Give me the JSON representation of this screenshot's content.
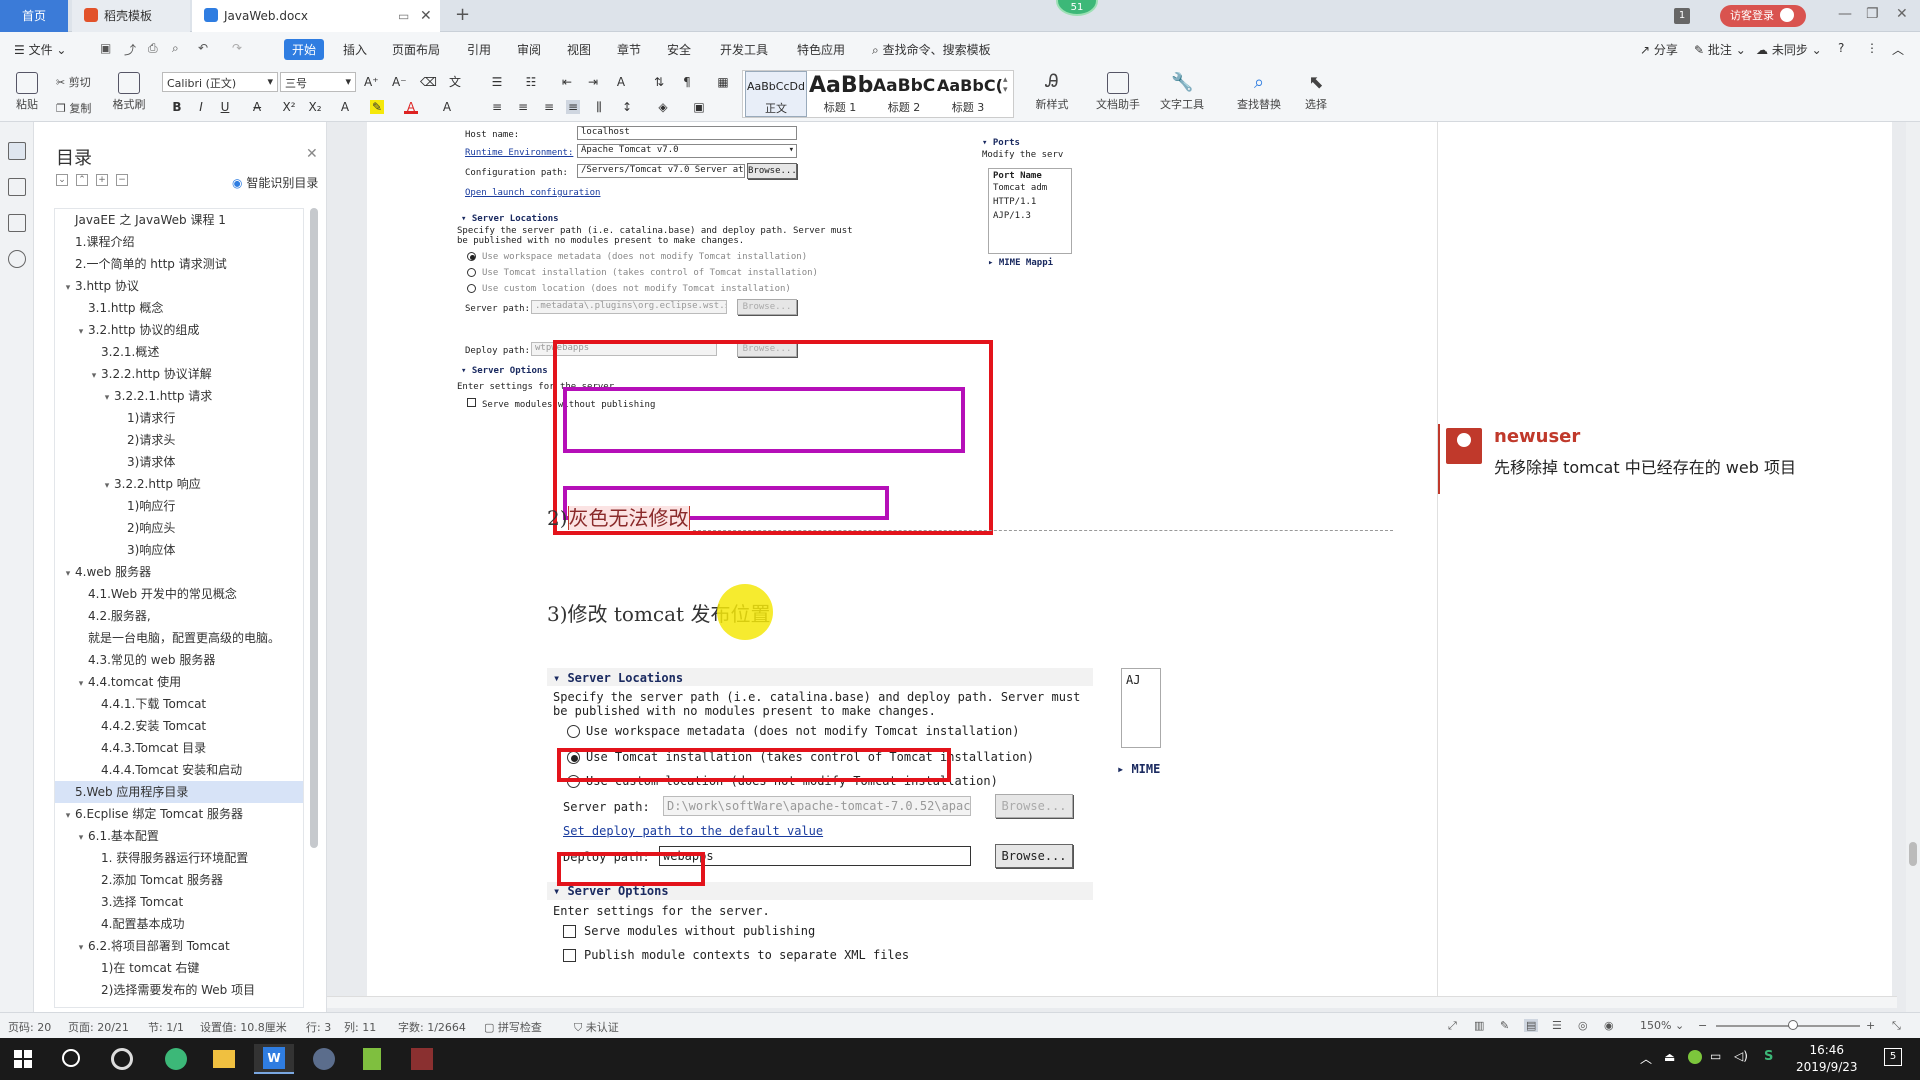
{
  "tabs": {
    "home": "首页",
    "template": "稻壳模板",
    "document": "JavaWeb.docx",
    "window_count": "1",
    "login": "访客登录",
    "float_badge": "51"
  },
  "menubar": {
    "file": "文件",
    "start": "开始",
    "items": [
      "插入",
      "页面布局",
      "引用",
      "审阅",
      "视图",
      "章节",
      "安全",
      "开发工具",
      "特色应用"
    ],
    "search": "查找命令、搜索模板",
    "share": "分享",
    "annotate": "批注",
    "sync": "未同步"
  },
  "toolbar": {
    "paste": "粘贴",
    "cut": "剪切",
    "copy": "复制",
    "format_painter": "格式刷",
    "font_name": "Calibri (正文)",
    "font_size": "三号",
    "styles": [
      {
        "preview": "AaBbCcDd",
        "label": "正文"
      },
      {
        "preview": "AaBb",
        "label": "标题 1"
      },
      {
        "preview": "AaBbC",
        "label": "标题 2"
      },
      {
        "preview": "AaBbC(",
        "label": "标题 3"
      }
    ],
    "new_style": "新样式",
    "doc_helper": "文档助手",
    "text_tools": "文字工具",
    "find_replace": "查找替换",
    "select": "选择"
  },
  "toc": {
    "title": "目录",
    "smart": "智能识别目录",
    "items": [
      {
        "text": "JavaEE 之 JavaWeb 课程 1",
        "level": 0,
        "caret": ""
      },
      {
        "text": "1.课程介绍",
        "level": 0,
        "caret": ""
      },
      {
        "text": "2.一个简单的 http 请求测试",
        "level": 0,
        "caret": ""
      },
      {
        "text": "3.http 协议",
        "level": 0,
        "caret": "v"
      },
      {
        "text": "3.1.http 概念",
        "level": 1,
        "caret": ""
      },
      {
        "text": "3.2.http 协议的组成",
        "level": 1,
        "caret": "v"
      },
      {
        "text": "3.2.1.概述",
        "level": 2,
        "caret": ""
      },
      {
        "text": "3.2.2.http 协议详解",
        "level": 2,
        "caret": "v"
      },
      {
        "text": "3.2.2.1.http 请求",
        "level": 3,
        "caret": "v"
      },
      {
        "text": "1)请求行",
        "level": 4,
        "caret": ""
      },
      {
        "text": "2)请求头",
        "level": 4,
        "caret": ""
      },
      {
        "text": "3)请求体",
        "level": 4,
        "caret": ""
      },
      {
        "text": "3.2.2.http 响应",
        "level": 3,
        "caret": "v"
      },
      {
        "text": "1)响应行",
        "level": 4,
        "caret": ""
      },
      {
        "text": "2)响应头",
        "level": 4,
        "caret": ""
      },
      {
        "text": "3)响应体",
        "level": 4,
        "caret": ""
      },
      {
        "text": "4.web 服务器",
        "level": 0,
        "caret": "v"
      },
      {
        "text": "4.1.Web 开发中的常见概念",
        "level": 1,
        "caret": ""
      },
      {
        "text": "4.2.服务器,",
        "level": 1,
        "caret": ""
      },
      {
        "text": "就是一台电脑，配置更高级的电脑。",
        "level": 1,
        "caret": ""
      },
      {
        "text": "4.3.常见的 web 服务器",
        "level": 1,
        "caret": ""
      },
      {
        "text": "4.4.tomcat 使用",
        "level": 1,
        "caret": "v"
      },
      {
        "text": "4.4.1.下载 Tomcat",
        "level": 2,
        "caret": ""
      },
      {
        "text": "4.4.2.安装 Tomcat",
        "level": 2,
        "caret": ""
      },
      {
        "text": "4.4.3.Tomcat 目录",
        "level": 2,
        "caret": ""
      },
      {
        "text": "4.4.4.Tomcat 安装和启动",
        "level": 2,
        "caret": ""
      },
      {
        "text": "5.Web 应用程序目录",
        "level": 0,
        "caret": "",
        "selected": true
      },
      {
        "text": "6.Ecplise 绑定 Tomcat 服务器",
        "level": 0,
        "caret": "v"
      },
      {
        "text": "6.1.基本配置",
        "level": 1,
        "caret": "v"
      },
      {
        "text": "1. 获得服务器运行环境配置",
        "level": 2,
        "caret": ""
      },
      {
        "text": "2.添加 Tomcat 服务器",
        "level": 2,
        "caret": ""
      },
      {
        "text": "3.选择 Tomcat",
        "level": 2,
        "caret": ""
      },
      {
        "text": "4.配置基本成功",
        "level": 2,
        "caret": ""
      },
      {
        "text": "6.2.将项目部署到 Tomcat",
        "level": 1,
        "caret": "v"
      },
      {
        "text": "1)在 tomcat 右键",
        "level": 2,
        "caret": ""
      },
      {
        "text": "2)选择需要发布的 Web 项目",
        "level": 2,
        "caret": ""
      }
    ]
  },
  "shot1": {
    "host_label": "Host name:",
    "host_value": "localhost",
    "runtime_label": "Runtime Environment:",
    "runtime_value": "Apache Tomcat v7.0",
    "config_label": "Configuration path:",
    "config_value": "/Servers/Tomcat v7.0 Server at local",
    "browse": "Browse...",
    "open_launch": "Open launch configuration",
    "section": "Server Locations",
    "desc1": "Specify the server path (i.e. catalina.base) and deploy path. Server must",
    "desc2": "be published with no modules present to make changes.",
    "opt1": "Use workspace metadata (does not modify Tomcat installation)",
    "opt2": "Use Tomcat installation (takes control of Tomcat installation)",
    "opt3": "Use custom location (does not modify Tomcat installation)",
    "server_path_label": "Server path:",
    "server_path_value": ".metadata\\.plugins\\org.eclipse.wst.server.",
    "deploy_label": "Deploy path:",
    "deploy_value": "wtpwebapps",
    "options_section": "Server Options",
    "options_desc": "Enter settings for the server.",
    "serve_modules": "Serve modules without publishing",
    "ports": "Ports",
    "ports_desc": "Modify the serv",
    "port_name": "Port Name",
    "port1": "Tomcat adm",
    "port2": "HTTP/1.1",
    "port3": "AJP/1.3",
    "mime": "MIME Mappi"
  },
  "doc": {
    "line2_prefix": "2)",
    "line2": "灰色无法修改",
    "line3": "3)修改 tomcat 发布位置"
  },
  "shot2": {
    "section": "Server Locations",
    "desc1": "Specify the server path (i.e. catalina.base) and deploy path. Server must",
    "desc2": "be published with no modules present to make changes.",
    "opt1": "Use workspace metadata (does not modify Tomcat installation)",
    "opt2": "Use Tomcat installation (takes control of Tomcat installation)",
    "opt3": "Use custom location (does not modify Tomcat installation)",
    "server_path_label": "Server path:",
    "server_path_value": "D:\\work\\softWare\\apache-tomcat-7.0.52\\apac",
    "set_default": "Set deploy path to the default value",
    "deploy_label": "Deploy path:",
    "deploy_value": "webapps",
    "browse": "Browse...",
    "options_section": "Server Options",
    "options_desc": "Enter settings for the server.",
    "serve_modules": "Serve modules without publishing",
    "publish_contexts": "Publish module contexts to separate XML files",
    "side_ajp": "AJ",
    "side_mime": "MIME"
  },
  "comment": {
    "user": "newuser",
    "text": "先移除掉 tomcat 中已经存在的 web 项目"
  },
  "status": {
    "pages": "页码: 20",
    "page": "页面: 20/21",
    "section": "节: 1/1",
    "setting": "设置值: 10.8厘米",
    "row": "行: 3",
    "col": "列: 11",
    "words": "字数: 1/2664",
    "spell": "拼写检查",
    "auth": "未认证",
    "zoom": "150%"
  },
  "taskbar": {
    "time": "16:46",
    "date": "2019/9/23"
  },
  "colors": {
    "accent": "#2f7de1",
    "red_box": "#e3131b",
    "magenta_box": "#b50fb8",
    "comment_user": "#c0392b",
    "highlight": "#f5e80b"
  }
}
